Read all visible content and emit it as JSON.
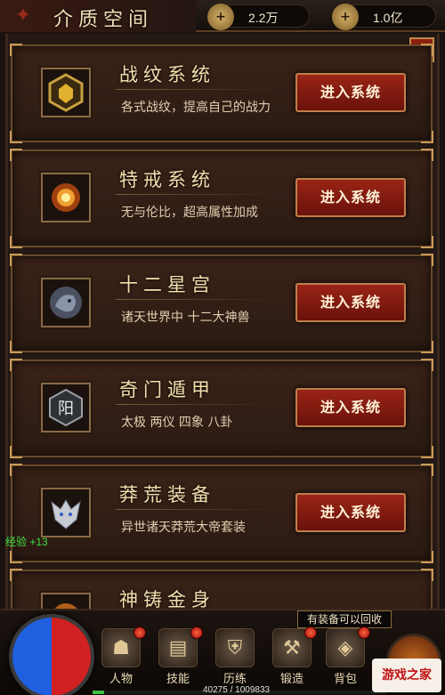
{
  "header": {
    "title": "介质空间",
    "silver": {
      "icon": "silver-coin-icon",
      "value": "2.2万"
    },
    "gold": {
      "icon": "gold-ingot-icon",
      "value": "1.0亿"
    }
  },
  "cards": [
    {
      "title": "战纹系统",
      "desc": "各式战纹，提高自己的战力",
      "button": "进入系统",
      "icon": "war-pattern-icon"
    },
    {
      "title": "特戒系统",
      "desc": "无与伦比，超高属性加成",
      "button": "进入系统",
      "icon": "special-ring-icon"
    },
    {
      "title": "十二星宫",
      "desc": "诸天世界中 十二大神兽",
      "button": "进入系统",
      "icon": "dragon-icon"
    },
    {
      "title": "奇门遁甲",
      "desc": "太极 两仪 四象 八卦",
      "button": "进入系统",
      "icon": "yang-seal-icon",
      "seal_char": "阳"
    },
    {
      "title": "莽荒装备",
      "desc": "异世诸天莽荒大帝套装",
      "button": "进入系统",
      "icon": "wolf-head-icon"
    },
    {
      "title": "神铸金身",
      "desc": "",
      "button": "",
      "icon": "golden-body-icon"
    }
  ],
  "exp_gain": "经验 +13",
  "tooltip": "有装备可以回收",
  "nav": [
    {
      "label": "人物",
      "icon": "character-icon"
    },
    {
      "label": "技能",
      "icon": "skill-book-icon"
    },
    {
      "label": "历练",
      "icon": "armor-icon"
    },
    {
      "label": "锻造",
      "icon": "anvil-icon"
    },
    {
      "label": "背包",
      "icon": "bag-icon"
    }
  ],
  "xp": {
    "text": "40275 / 1009833",
    "fraction": 0.0399
  },
  "watermark": "游戏之家"
}
